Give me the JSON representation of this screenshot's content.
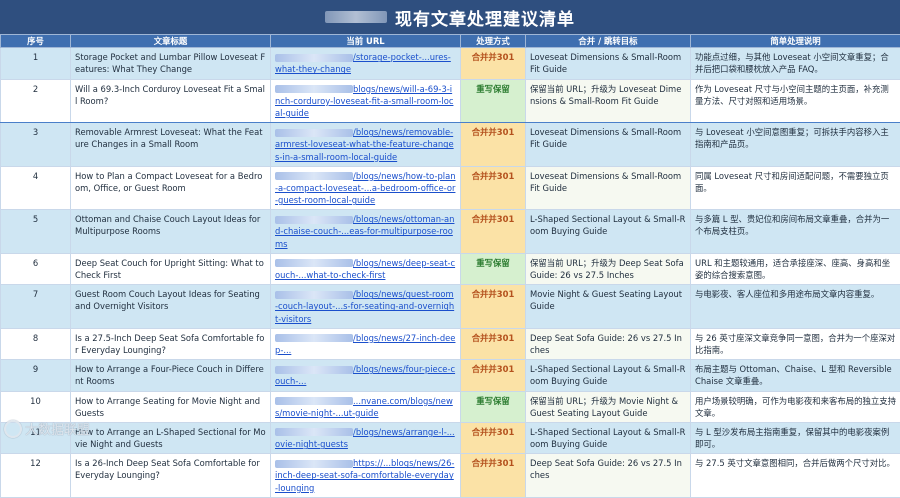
{
  "title": "现有文章处理建议清单",
  "columns": [
    "序号",
    "文章标题",
    "当前 URL",
    "处理方式",
    "合并 / 跳转目标",
    "简单处理说明"
  ],
  "rows": [
    {
      "no": "1",
      "title": "Storage Pocket and Lumbar Pillow Loveseat Features: What They Change",
      "url": "/storage-pocket-...ures-what-they-change",
      "action": "合并并301",
      "action_type": "merge",
      "target": "Loveseat Dimensions & Small-Room Fit Guide",
      "note": "功能点过细，与其他 Loveseat 小空间文章重复；合并后把口袋和腰枕放入产品 FAQ。"
    },
    {
      "no": "2",
      "title": "Will a 69.3-Inch Corduroy Loveseat Fit a Small Room?",
      "url": "blogs/news/will-a-69-3-inch-corduroy-loveseat-fit-a-small-room-local-guide",
      "action": "重写保留",
      "action_type": "keep",
      "target": "保留当前 URL；升级为 Loveseat Dimensions & Small-Room Fit Guide",
      "note": "作为 Loveseat 尺寸与小空间主题的主页面，补充测量方法、尺寸对照和适用场景。"
    },
    {
      "no": "3",
      "title": "Removable Armrest Loveseat: What the Feature Changes in a Small Room",
      "url": "/blogs/news/removable-armrest-loveseat-what-the-feature-changes-in-a-small-room-local-guide",
      "action": "合并并301",
      "action_type": "merge",
      "target": "Loveseat Dimensions & Small-Room Fit Guide",
      "note": "与 Loveseat 小空间意图重复；可拆扶手内容移入主指南和产品页。"
    },
    {
      "no": "4",
      "title": "How to Plan a Compact Loveseat for a Bedroom, Office, or Guest Room",
      "url": "/blogs/news/how-to-plan-a-compact-loveseat-...a-bedroom-office-or-guest-room-local-guide",
      "action": "合并并301",
      "action_type": "merge",
      "target": "Loveseat Dimensions & Small-Room Fit Guide",
      "note": "同属 Loveseat 尺寸和房间适配问题，不需要独立页面。"
    },
    {
      "no": "5",
      "title": "Ottoman and Chaise Couch Layout Ideas for Multipurpose Rooms",
      "url": "/blogs/news/ottoman-and-chaise-couch-...eas-for-multipurpose-rooms",
      "action": "合并并301",
      "action_type": "merge",
      "target": "L-Shaped Sectional Layout & Small-Room Buying Guide",
      "note": "与多篇 L 型、贵妃位和房间布局文章重叠，合并为一个布局支柱页。"
    },
    {
      "no": "6",
      "title": "Deep Seat Couch for Upright Sitting: What to Check First",
      "url": "/blogs/news/deep-seat-couch-...what-to-check-first",
      "action": "重写保留",
      "action_type": "keep",
      "target": "保留当前 URL；升级为 Deep Seat Sofa Guide: 26 vs 27.5 Inches",
      "note": "URL 和主题较通用，适合承接座深、座高、身高和坐姿的综合搜索意图。"
    },
    {
      "no": "7",
      "title": "Guest Room Couch Layout Ideas for Seating and Overnight Visitors",
      "url": "/blogs/news/guest-room-couch-layout-...s-for-seating-and-overnight-visitors",
      "action": "合并并301",
      "action_type": "merge",
      "target": "Movie Night & Guest Seating Layout Guide",
      "note": "与电影夜、客人座位和多用途布局文章内容重复。"
    },
    {
      "no": "8",
      "title": "Is a 27.5-Inch Deep Seat Sofa Comfortable for Everyday Lounging?",
      "url": "/blogs/news/27-inch-deep-...",
      "action": "合并并301",
      "action_type": "merge",
      "target": "Deep Seat Sofa Guide: 26 vs 27.5 Inches",
      "note": "与 26 英寸座深文章竞争同一意图，合并为一个座深对比指南。"
    },
    {
      "no": "9",
      "title": "How to Arrange a Four-Piece Couch in Different Rooms",
      "url": "/blogs/news/four-piece-couch-...",
      "action": "合并并301",
      "action_type": "merge",
      "target": "L-Shaped Sectional Layout & Small-Room Buying Guide",
      "note": "布局主题与 Ottoman、Chaise、L 型和 Reversible Chaise 文章重叠。"
    },
    {
      "no": "10",
      "title": "How to Arrange Seating for Movie Night and Guests",
      "url": "...nvane.com/blogs/news/movie-night-...ut-guide",
      "action": "重写保留",
      "action_type": "keep",
      "target": "保留当前 URL；升级为 Movie Night & Guest Seating Layout Guide",
      "note": "用户场景较明确，可作为电影夜和来客布局的独立支持文章。"
    },
    {
      "no": "11",
      "title": "How to Arrange an L-Shaped Sectional for Movie Night and Guests",
      "url": "/blogs/news/arrange-l-...ovie-night-guests",
      "action": "合并并301",
      "action_type": "merge",
      "target": "L-Shaped Sectional Layout & Small-Room Buying Guide",
      "note": "与 L 型沙发布局主指南重复，保留其中的电影夜案例即可。"
    },
    {
      "no": "12",
      "title": "Is a 26-Inch Deep Seat Sofa Comfortable for Everyday Lounging?",
      "url": "https://...blogs/news/26-inch-deep-seat-sofa-comfortable-everyday-lounging",
      "action": "合并并301",
      "action_type": "merge",
      "target": "Deep Seat Sofa Guide: 26 vs 27.5 Inches",
      "note": "与 27.5 英寸文章意图相同，合并后做两个尺寸对比。"
    }
  ],
  "watermark": "大数据联盟"
}
